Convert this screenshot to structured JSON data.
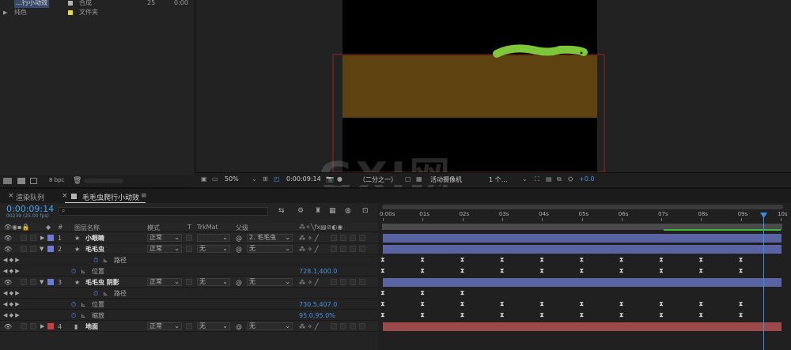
{
  "project": {
    "rows": [
      {
        "name": "…行小动效",
        "type": "合成",
        "num": "25",
        "dur": "0:00",
        "color": "#b4b4b4"
      },
      {
        "name": "纯色",
        "type": "文件夹",
        "num": "",
        "dur": "",
        "color": "#e8d44d"
      }
    ],
    "bpc": "8 bpc"
  },
  "viewer": {
    "zoom": "50%",
    "timecode": "0:00:09:14",
    "resolution": "（二分之一）",
    "camera": "活动摄像机",
    "views": "1 个…",
    "exposure": "+0.0"
  },
  "tabs": {
    "render_queue": "渲染队列",
    "comp": "毛毛虫爬行小动效"
  },
  "timeline": {
    "timecode": "0:00:09:14",
    "sub_timecode": "00239 (25.00 fps)",
    "search_placeholder": "",
    "headers": {
      "num": "#",
      "layer_name": "图层名称",
      "mode": "模式",
      "t": "T",
      "trkmat": "TrkMat",
      "parent": "父级"
    },
    "ruler": [
      "0:00s",
      "01s",
      "02s",
      "03s",
      "04s",
      "05s",
      "06s",
      "07s",
      "08s",
      "09s",
      "10s"
    ],
    "rows": [
      {
        "kind": "layer",
        "num": "1",
        "name": "小眼睛",
        "mode": "正常",
        "trkmat": "",
        "parent": "2. 毛毛虫",
        "label": "#6c7bd8",
        "bar": "#5b64a3"
      },
      {
        "kind": "layer",
        "num": "2",
        "name": "毛毛虫",
        "mode": "正常",
        "trkmat": "无",
        "parent": "无",
        "label": "#6c7bd8",
        "bar": "#5b64a3",
        "expanded": true
      },
      {
        "kind": "prop",
        "name": "路径",
        "value": ""
      },
      {
        "kind": "prop",
        "name": "位置",
        "value": "728.1,400.0"
      },
      {
        "kind": "layer",
        "num": "3",
        "name": "毛毛虫 阴影",
        "mode": "正常",
        "trkmat": "无",
        "parent": "无",
        "label": "#6c7bd8",
        "bar": "#5b64a3",
        "expanded": true
      },
      {
        "kind": "prop",
        "name": "路径",
        "value": ""
      },
      {
        "kind": "prop",
        "name": "位置",
        "value": "730.5,407.0"
      },
      {
        "kind": "prop",
        "name": "缩放",
        "value": "95.0,95.0%"
      },
      {
        "kind": "layer",
        "num": "4",
        "name": "地面",
        "mode": "正常",
        "trkmat": "无",
        "parent": "无",
        "label": "#c94040",
        "bar": "#9a4a4a"
      }
    ]
  },
  "watermark": {
    "text1": "GXI网",
    "text2": "system.com"
  },
  "colors": {
    "accent": "#2d8ceb",
    "ground": "#6b4a12",
    "worm": "#7ec63a"
  }
}
